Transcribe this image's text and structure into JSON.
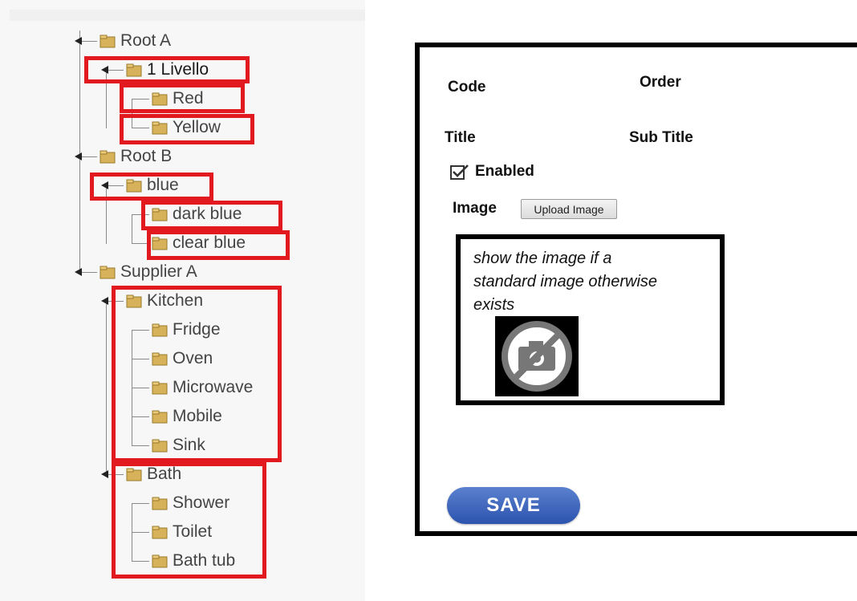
{
  "tree": {
    "nodes": [
      {
        "id": "root-a",
        "label": "Root A"
      },
      {
        "id": "livello",
        "label": "1 Livello"
      },
      {
        "id": "red",
        "label": "Red"
      },
      {
        "id": "yellow",
        "label": "Yellow"
      },
      {
        "id": "root-b",
        "label": "Root B"
      },
      {
        "id": "blue",
        "label": "blue"
      },
      {
        "id": "dark-blue",
        "label": "dark blue"
      },
      {
        "id": "clear-blue",
        "label": "clear blue"
      },
      {
        "id": "supplier-a",
        "label": "Supplier A"
      },
      {
        "id": "kitchen",
        "label": "Kitchen"
      },
      {
        "id": "fridge",
        "label": "Fridge"
      },
      {
        "id": "oven",
        "label": "Oven"
      },
      {
        "id": "microwave",
        "label": "Microwave"
      },
      {
        "id": "mobile",
        "label": "Mobile"
      },
      {
        "id": "sink",
        "label": "Sink"
      },
      {
        "id": "bath",
        "label": "Bath"
      },
      {
        "id": "shower",
        "label": "Shower"
      },
      {
        "id": "toilet",
        "label": "Toilet"
      },
      {
        "id": "bath-tub",
        "label": "Bath tub"
      }
    ],
    "folder_icon": "folder-icon",
    "highlight_color": "#e2191f"
  },
  "form": {
    "code_label": "Code",
    "order_label": "Order",
    "title_label": "Title",
    "subtitle_label": "Sub Title",
    "enabled_label": "Enabled",
    "enabled_checked": true,
    "image_label": "Image",
    "upload_label": "Upload Image",
    "image_note": "show the image if a standard image otherwise exists",
    "no_image_icon": "no-camera-icon",
    "save_label": "SAVE",
    "save_color": "#2d54ae"
  }
}
